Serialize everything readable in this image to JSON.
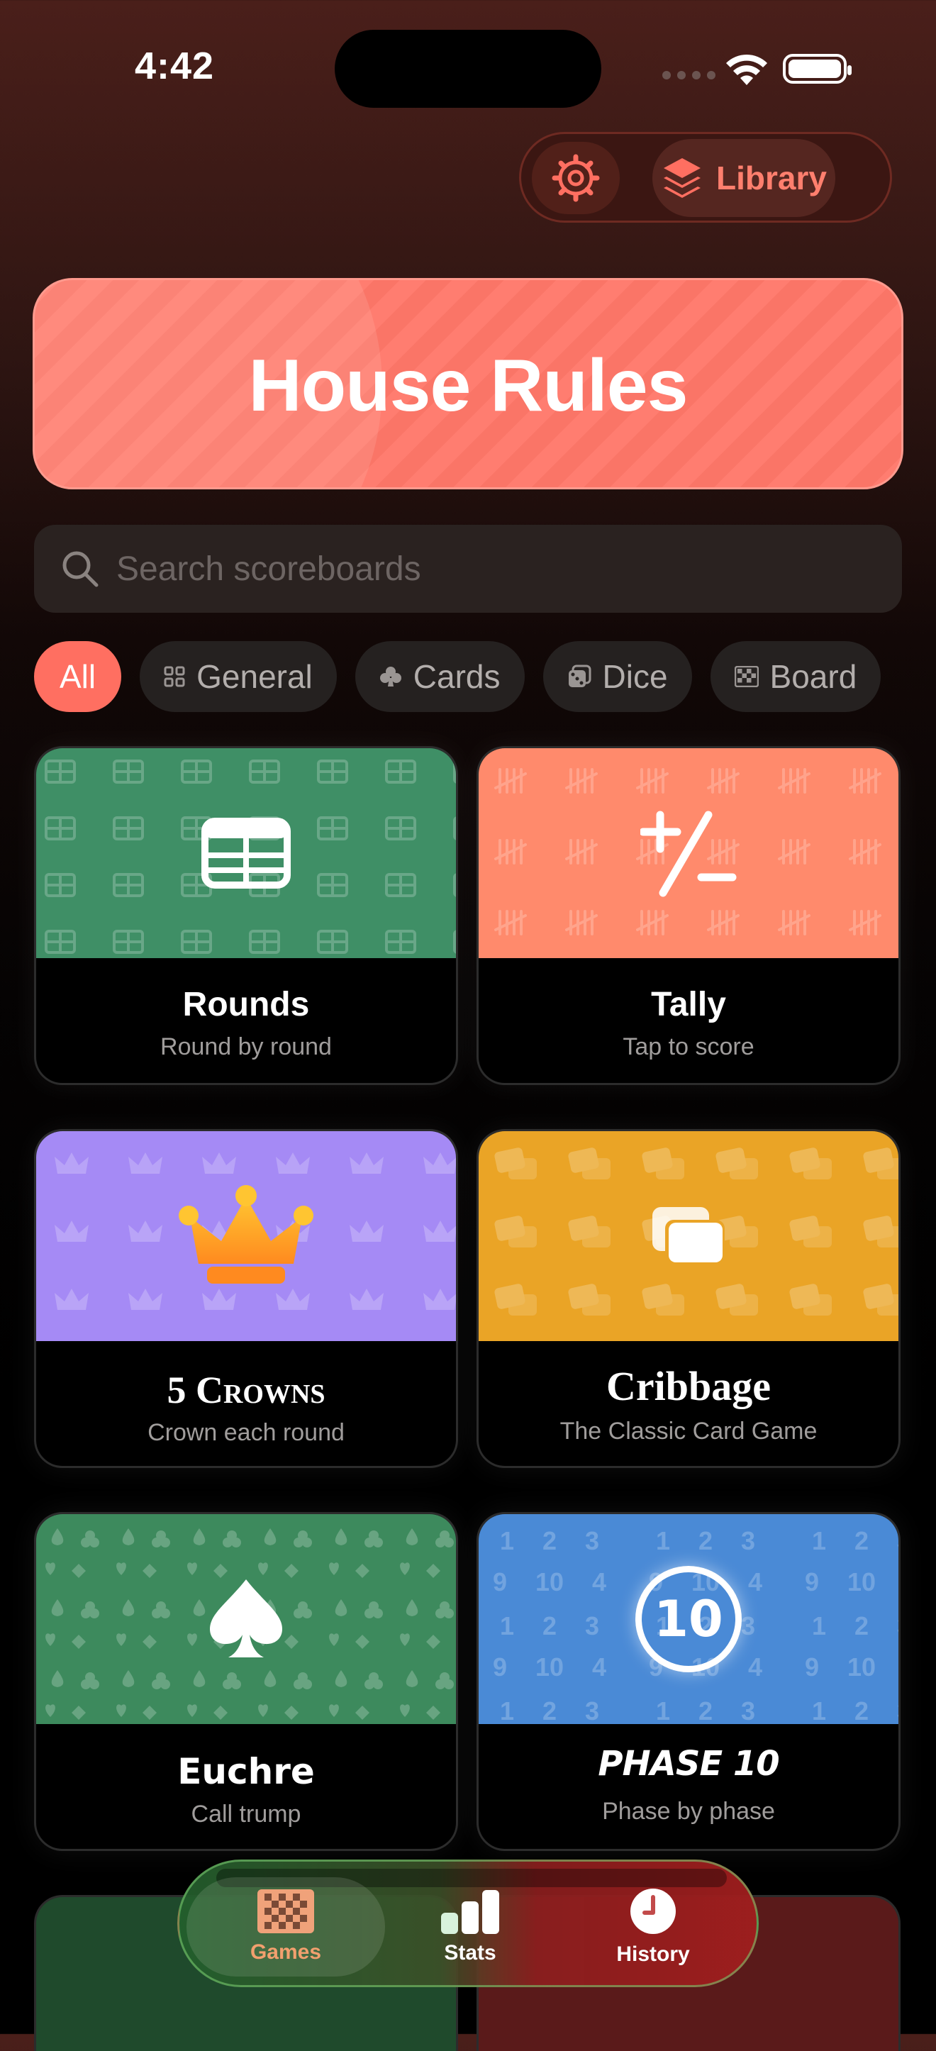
{
  "status_bar": {
    "time": "4:42"
  },
  "header": {
    "library_label": "Library"
  },
  "banner": {
    "title": "House Rules"
  },
  "search": {
    "placeholder": "Search scoreboards"
  },
  "filters": [
    {
      "label": "All",
      "icon": "",
      "active": true
    },
    {
      "label": "General",
      "icon": "grid-icon"
    },
    {
      "label": "Cards",
      "icon": "club-icon"
    },
    {
      "label": "Dice",
      "icon": "dice-icon"
    },
    {
      "label": "Board",
      "icon": "checker-icon"
    }
  ],
  "games": [
    {
      "name": "Rounds",
      "subtitle": "Round by round",
      "color": "#3f8f66",
      "icon": "table-icon"
    },
    {
      "name": "Tally",
      "subtitle": "Tap to score",
      "color": "#ff8a6c",
      "icon": "plus-minus-icon"
    },
    {
      "name": "5 Crowns",
      "subtitle": "Crown each round",
      "color": "#a58af5",
      "icon": "crown-icon"
    },
    {
      "name": "Cribbage",
      "subtitle": "The Classic Card Game",
      "color": "#eaa426",
      "icon": "cards-icon"
    },
    {
      "name": "Euchre",
      "subtitle": "Call trump",
      "color": "#3d8a5d",
      "icon": "spade-icon"
    },
    {
      "name": "PHASE 10",
      "subtitle": "Phase by phase",
      "color": "#4a8ad6",
      "icon": "ten-badge-icon",
      "badge_text": "10"
    }
  ],
  "tabbar": {
    "tabs": [
      {
        "label": "Games",
        "icon": "checkerboard-icon",
        "active": true
      },
      {
        "label": "Stats",
        "icon": "bar-chart-icon"
      },
      {
        "label": "History",
        "icon": "clock-icon"
      }
    ]
  },
  "colors": {
    "accent": "#ff6f61",
    "banner": "#ff7d70"
  }
}
